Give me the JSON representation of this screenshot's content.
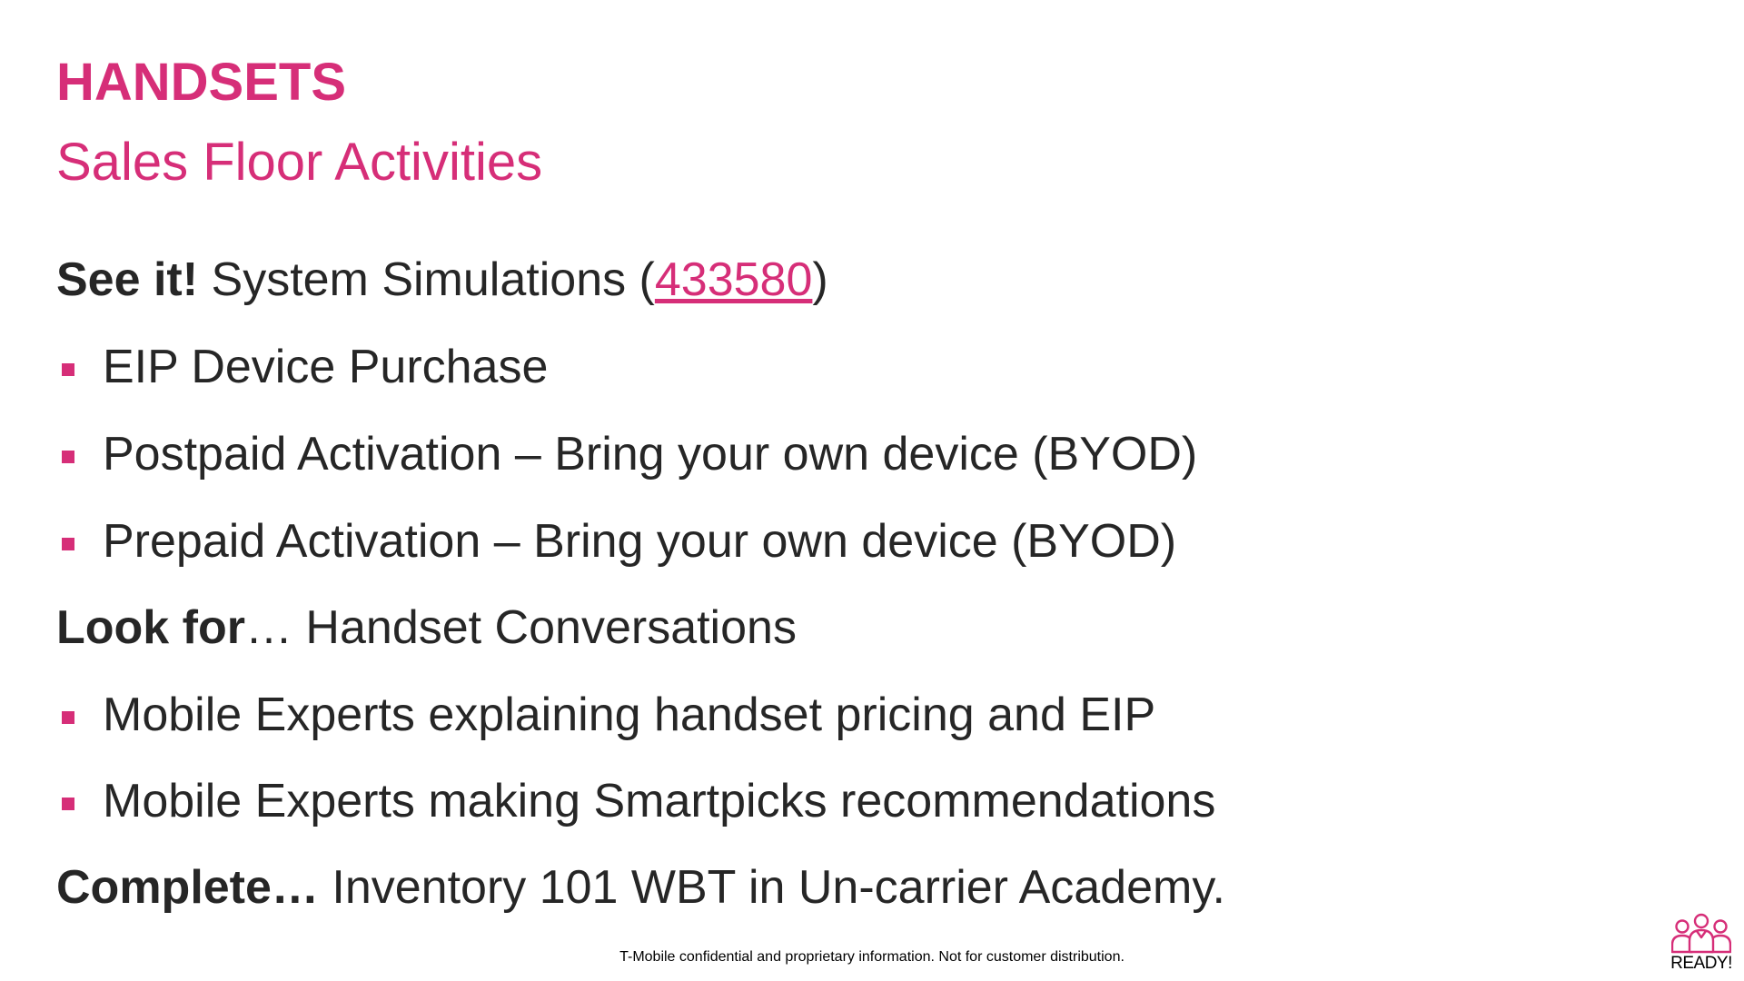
{
  "slide": {
    "title": "HANDSETS",
    "subtitle": "Sales Floor Activities"
  },
  "see_it": {
    "lead": "See it!",
    "text": " System Simulations (",
    "link": "433580",
    "close": ")"
  },
  "see_it_items": [
    "EIP Device Purchase",
    "Postpaid Activation – Bring your own device (BYOD)",
    "Prepaid Activation – Bring your own device (BYOD)"
  ],
  "look_for": {
    "lead": "Look for",
    "text": "… Handset Conversations"
  },
  "look_for_items": [
    "Mobile Experts explaining handset pricing and EIP",
    "Mobile Experts making Smartpicks recommendations"
  ],
  "complete": {
    "lead": "Complete…",
    "text": " Inventory 101 WBT in Un-carrier Academy."
  },
  "footer": "T-Mobile confidential and proprietary information. Not for customer distribution.",
  "logo": {
    "label": "READY!",
    "icon": "people-group-icon"
  },
  "colors": {
    "accent": "#d62e78",
    "text": "#262626"
  }
}
